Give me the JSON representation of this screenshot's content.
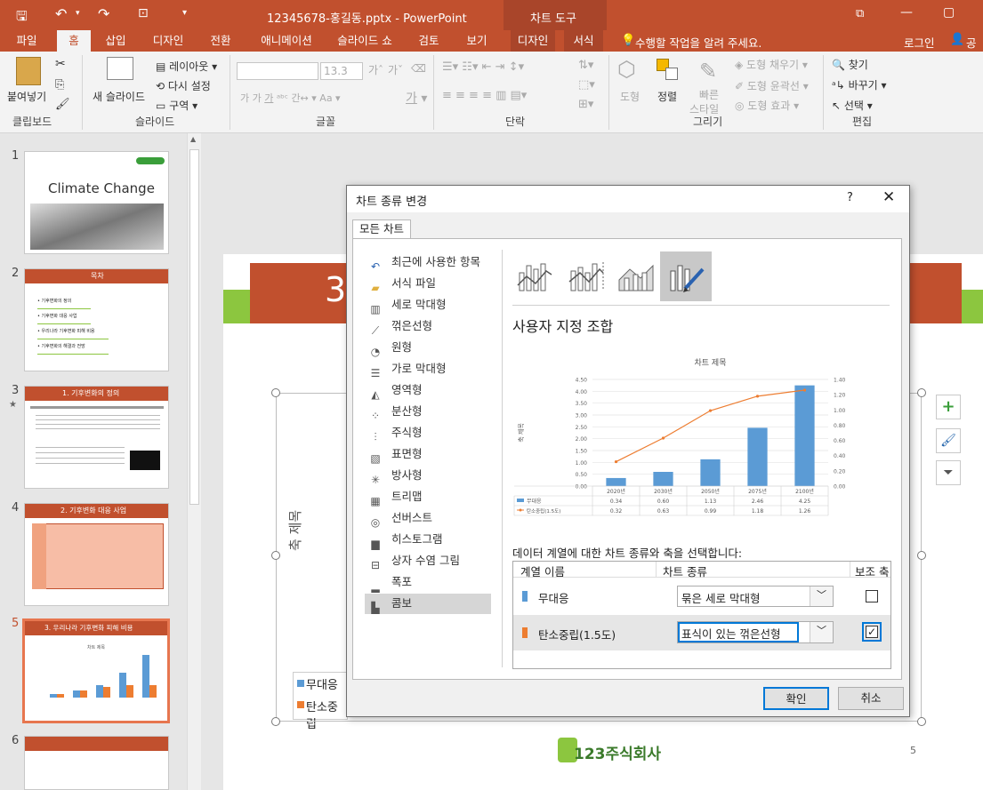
{
  "titlebar": {
    "title": "12345678-홍길동.pptx - PowerPoint",
    "context_tab": "차트 도구"
  },
  "tabs": [
    "파일",
    "홈",
    "삽입",
    "디자인",
    "전환",
    "애니메이션",
    "슬라이드 쇼",
    "검토",
    "보기",
    "디자인",
    "서식"
  ],
  "tell_me": "수행할 작업을 알려 주세요.",
  "login": "로그인",
  "share": "공유",
  "ribbon": {
    "paste": "붙여넣기",
    "new_slide": "새 슬라이드",
    "layout": "레이아웃",
    "reset": "다시 설정",
    "section": "구역",
    "font_size": "13.3",
    "shape": "도형",
    "arrange": "정렬",
    "quick_style_1": "빠른",
    "quick_style_2": "스타일",
    "fill": "도형 채우기",
    "outline": "도형 윤곽선",
    "effect": "도형 효과",
    "find": "찾기",
    "replace": "바꾸기",
    "select": "선택",
    "groups": [
      "클립보드",
      "슬라이드",
      "글꼴",
      "단락",
      "그리기",
      "편집"
    ]
  },
  "thumbnails": {
    "s1_title": "Climate Change",
    "s2_title": "목차",
    "s2_items": [
      "기후변화의 정의",
      "기후변화 대응 사업",
      "우리나라 기후변화 피해 비용",
      "기후변화의 해결과 전망"
    ],
    "s3_title": "1. 기후변화의 정의",
    "s4_title": "2. 기후변화 대응 사업",
    "s5_title": "3. 우리나라 기후변화 피해 비용",
    "s5_chart": "차트 제목",
    "numbers": [
      "1",
      "2",
      "3",
      "4",
      "5",
      "6"
    ]
  },
  "slide": {
    "number_big": "3",
    "y_axis": "축 제목",
    "legend": [
      "무대응",
      "탄소중립"
    ],
    "page_num": "5",
    "logo_text": "123주식회사"
  },
  "dialog": {
    "title": "차트 종류 변경",
    "help": "?",
    "tab": "모든 차트",
    "nav": [
      "최근에 사용한 항목",
      "서식 파일",
      "세로 막대형",
      "꺾은선형",
      "원형",
      "가로 막대형",
      "영역형",
      "분산형",
      "주식형",
      "표면형",
      "방사형",
      "트리맵",
      "선버스트",
      "히스토그램",
      "상자 수염 그림",
      "폭포",
      "콤보"
    ],
    "nav_icons": [
      "undo-icon",
      "folder-icon",
      "column-chart-icon",
      "line-chart-icon",
      "pie-chart-icon",
      "bar-chart-icon",
      "area-chart-icon",
      "scatter-chart-icon",
      "stock-chart-icon",
      "surface-chart-icon",
      "radar-chart-icon",
      "treemap-icon",
      "sunburst-icon",
      "histogram-icon",
      "box-whisker-icon",
      "waterfall-icon",
      "combo-chart-icon"
    ],
    "selected_nav": "콤보",
    "section_title": "사용자 지정 조합",
    "instruction": "데이터 계열에 대한 차트 종류와 축을 선택합니다:",
    "col_headers": [
      "계열 이름",
      "차트 종류",
      "보조 축"
    ],
    "series_rows": [
      {
        "name": "무대응",
        "type": "묶은 세로 막대형",
        "secondary": false,
        "color": "#5b9bd5"
      },
      {
        "name": "탄소중립(1.5도)",
        "type": "표식이 있는 꺾은선형",
        "secondary": true,
        "color": "#ed7d31"
      }
    ],
    "ok": "확인",
    "cancel": "취소"
  },
  "chart_data": {
    "type": "bar",
    "title": "차트 제목",
    "ylabel": "축 제목",
    "categories": [
      "2020년",
      "2030년",
      "2050년",
      "2075년",
      "2100년"
    ],
    "series": [
      {
        "name": "무대응",
        "type": "bar",
        "values": [
          0.34,
          0.6,
          1.13,
          2.46,
          4.25
        ],
        "color": "#5b9bd5",
        "axis": "primary"
      },
      {
        "name": "탄소중립(1.5도)",
        "type": "line",
        "values": [
          0.32,
          0.63,
          0.99,
          1.18,
          1.26
        ],
        "color": "#ed7d31",
        "axis": "secondary"
      }
    ],
    "ylim": [
      0,
      4.5
    ],
    "y_ticks": [
      "0.00",
      "0.50",
      "1.00",
      "1.50",
      "2.00",
      "2.50",
      "3.00",
      "3.50",
      "4.00",
      "4.50"
    ],
    "y2lim": [
      0,
      1.4
    ],
    "y2_ticks": [
      "0.00",
      "0.20",
      "0.40",
      "0.60",
      "0.80",
      "1.00",
      "1.20",
      "1.40"
    ],
    "table_labels": [
      [
        "0.34",
        "0.60",
        "1.13",
        "2.46",
        "4.25"
      ],
      [
        "0.32",
        "0.63",
        "0.99",
        "1.18",
        "1.26"
      ]
    ],
    "legend_names": [
      "무대응",
      "탄소중립(1.5도)"
    ],
    "grid": true
  },
  "colors": {
    "accent": "#c1502e",
    "green": "#8cc63f",
    "blue": "#5b9bd5",
    "orange": "#ed7d31",
    "select_blue": "#0078d7"
  }
}
